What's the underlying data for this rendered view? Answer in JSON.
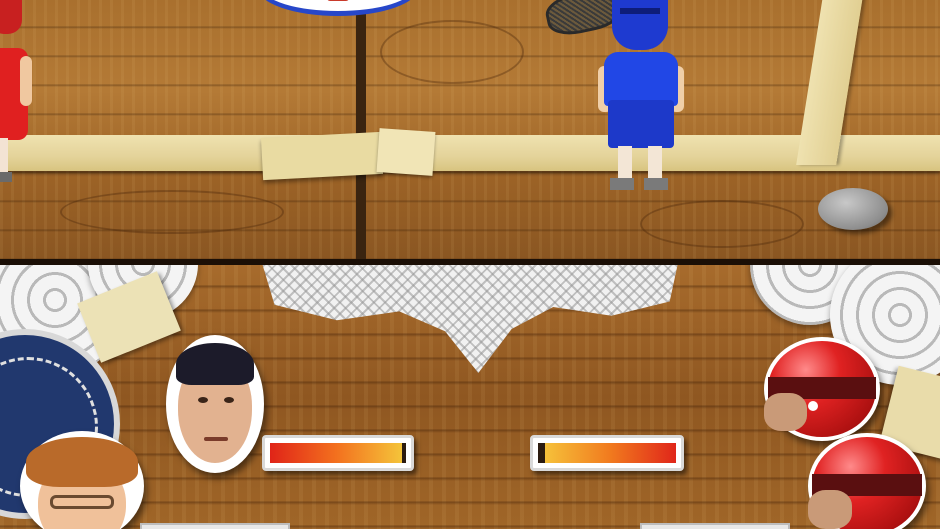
{
  "game": {
    "top_screen": {
      "players": [
        {
          "team": "red"
        },
        {
          "team": "blue"
        }
      ]
    },
    "bottom_screen": {
      "player_health_fraction": 0.97,
      "opponent_health_fraction": 0.95
    }
  },
  "colors": {
    "team_red": "#e02020",
    "team_blue": "#2147e6",
    "floor_wood": "#a9702e",
    "tape": "#e4d39a"
  },
  "icons": {
    "player_portrait_1": "coach-portrait",
    "player_portrait_2": "player-portrait",
    "opponent_portrait_1": "red-helmet-portrait",
    "opponent_portrait_2": "red-helmet-portrait"
  }
}
